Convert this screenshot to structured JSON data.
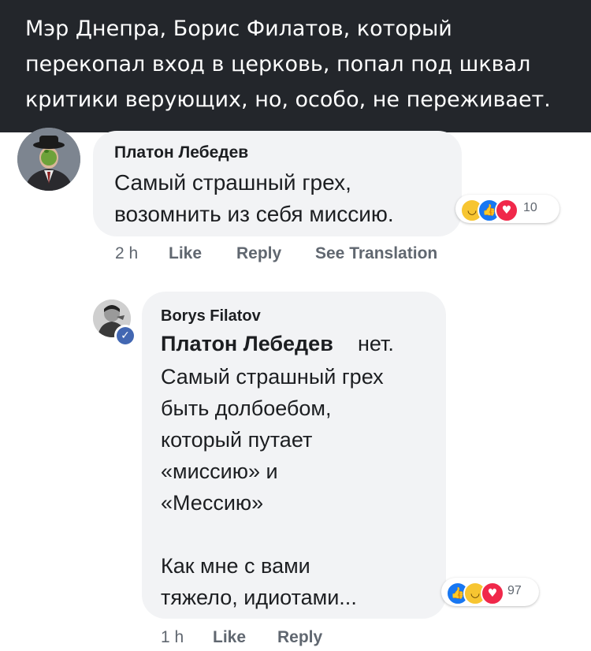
{
  "caption": {
    "line1": "Мэр Днепра, Борис Филатов, который",
    "line2": "перекопал вход в церковь, попал под шквал",
    "line3": "критики верующих, но, особо, не переживает."
  },
  "comment": {
    "author": "Платон Лебедев",
    "text": "Самый страшный грех,\nвозомнить из себя миссию.",
    "reaction_count": "10",
    "time": "2 h",
    "like_label": "Like",
    "reply_label": "Reply",
    "translate_label": "See Translation"
  },
  "reply": {
    "author": "Borys Filatov",
    "mention": "Платон Лебедев",
    "mention_rest": "нет.",
    "text": "Самый страшный грех\nбыть долбоебом,\nкоторый путает\n«миссию» и\n«Мессию»\n\nКак мне с вами\nтяжело, идиотами...",
    "reaction_count": "97",
    "time": "1 h",
    "like_label": "Like",
    "reply_label": "Reply"
  },
  "colors": {
    "header_bg": "#23262b",
    "bubble_bg": "#f2f3f5",
    "meta_text": "#606770",
    "verified": "#4267b2"
  },
  "icons": [
    "haha-reaction-icon",
    "like-reaction-icon",
    "love-reaction-icon",
    "verified-badge-icon"
  ]
}
